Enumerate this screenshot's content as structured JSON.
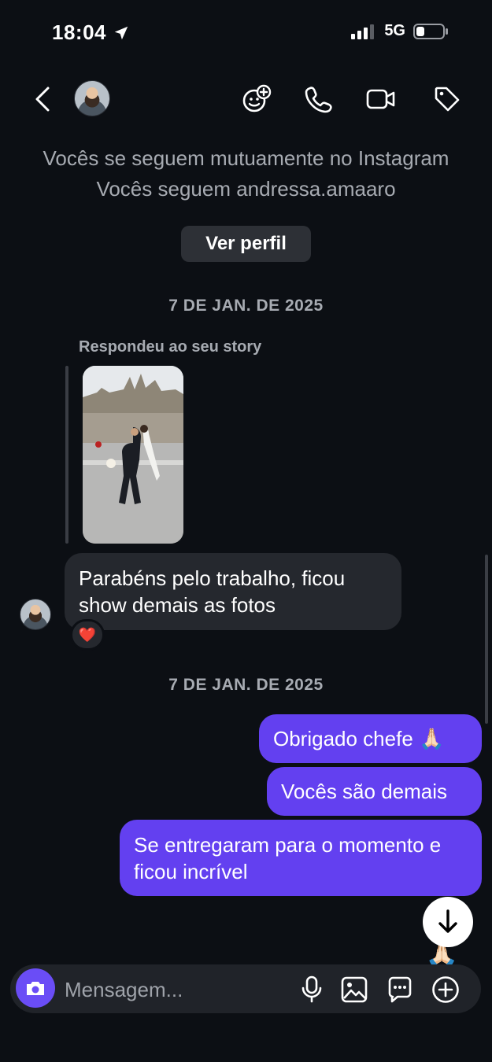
{
  "status_bar": {
    "time": "18:04",
    "network": "5G"
  },
  "header": {
    "back_icon": "chevron-left-icon",
    "icons": [
      "effects-add-icon",
      "phone-icon",
      "video-icon",
      "tag-icon"
    ]
  },
  "info": {
    "line1": "Vocês se seguem mutuamente no Instagram",
    "line2": "Vocês seguem andressa.amaaro",
    "profile_button": "Ver perfil"
  },
  "thread": {
    "date1": "7 DE JAN. DE 2025",
    "reply_label": "Respondeu ao seu story",
    "incoming_message": "Parabéns pelo trabalho, ficou show demais as fotos",
    "reaction": "❤️",
    "date2": "7 DE JAN. DE 2025",
    "outgoing": [
      "Obrigado chefe 🙏🏻",
      "Vocês são demais",
      "Se entregaram para o momento e ficou incrível"
    ],
    "floating_reaction": "🙏🏻"
  },
  "composer": {
    "placeholder": "Mensagem...",
    "icons": [
      "camera-icon",
      "microphone-icon",
      "gallery-icon",
      "sticker-chat-icon",
      "plus-icon"
    ]
  },
  "colors": {
    "background": "#0c0f14",
    "outgoing_bubble": "#6340f0",
    "incoming_bubble": "#25282e",
    "muted_text": "#a7abb2"
  }
}
